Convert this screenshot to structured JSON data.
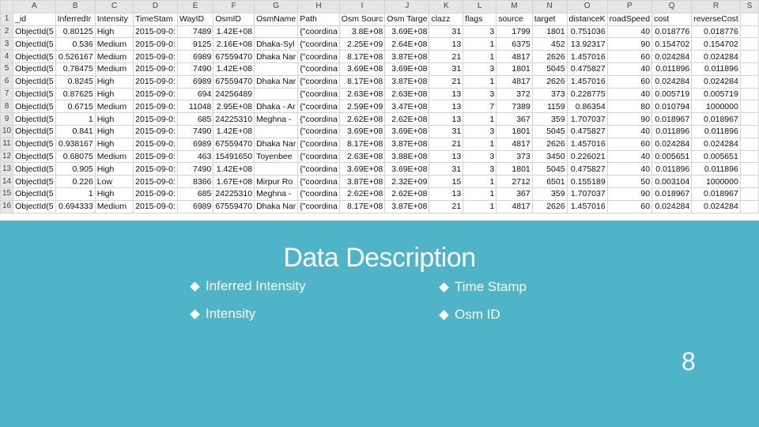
{
  "spreadsheet": {
    "column_letters": [
      "A",
      "B",
      "C",
      "D",
      "E",
      "F",
      "G",
      "H",
      "I",
      "J",
      "K",
      "L",
      "M",
      "N",
      "O",
      "P",
      "Q",
      "R",
      "S"
    ],
    "header_row": [
      "_id",
      "InferredIr",
      "Intensity",
      "TimeStam",
      "WayID",
      "OsmID",
      "OsmName",
      "Path",
      "Osm Sourc",
      "Osm Targe",
      "clazz",
      "flags",
      "source",
      "target",
      "distanceK",
      "roadSpeed",
      "cost",
      "reverseCost",
      ""
    ],
    "rows": [
      [
        "ObjectId(5",
        "0.80125",
        "High",
        "2015-09-0:",
        "7489",
        "1.42E+08",
        "",
        "{\"coordina",
        "3.8E+08",
        "3.69E+08",
        "31",
        "3",
        "1799",
        "1801",
        "0.751036",
        "40",
        "0.018776",
        "0.018776",
        ""
      ],
      [
        "ObjectId(5",
        "0.536",
        "Medium",
        "2015-09-0:",
        "9125",
        "2.16E+08",
        "Dhaka-Syl",
        "{\"coordina",
        "2.25E+09",
        "2.64E+08",
        "13",
        "1",
        "6375",
        "452",
        "13.92317",
        "90",
        "0.154702",
        "0.154702",
        ""
      ],
      [
        "ObjectId(5",
        "0.526167",
        "Medium",
        "2015-09-0:",
        "6989",
        "67559470",
        "Dhaka Nar",
        "{\"coordina",
        "8.17E+08",
        "3.87E+08",
        "21",
        "1",
        "4817",
        "2626",
        "1.457016",
        "60",
        "0.024284",
        "0.024284",
        ""
      ],
      [
        "ObjectId(5",
        "0.78475",
        "Medium",
        "2015-09-0:",
        "7490",
        "1.42E+08",
        "",
        "{\"coordina",
        "3.69E+08",
        "3.69E+08",
        "31",
        "3",
        "1801",
        "5045",
        "0.475827",
        "40",
        "0.011896",
        "0.011896",
        ""
      ],
      [
        "ObjectId(5",
        "0.8245",
        "High",
        "2015-09-0:",
        "6989",
        "67559470",
        "Dhaka Nar",
        "{\"coordina",
        "8.17E+08",
        "3.87E+08",
        "21",
        "1",
        "4817",
        "2626",
        "1.457016",
        "60",
        "0.024284",
        "0.024284",
        ""
      ],
      [
        "ObjectId(5",
        "0.87625",
        "High",
        "2015-09-0:",
        "694",
        "24256489",
        "",
        "{\"coordina",
        "2.63E+08",
        "2.63E+08",
        "13",
        "3",
        "372",
        "373",
        "0.228775",
        "40",
        "0.005719",
        "0.005719",
        ""
      ],
      [
        "ObjectId(5",
        "0.6715",
        "Medium",
        "2015-09-0:",
        "11048",
        "2.95E+08",
        "Dhaka - Ar",
        "{\"coordina",
        "2.59E+09",
        "3.47E+08",
        "13",
        "7",
        "7389",
        "1159",
        "0.86354",
        "80",
        "0.010794",
        "1000000",
        ""
      ],
      [
        "ObjectId(5",
        "1",
        "High",
        "2015-09-0:",
        "685",
        "24225310",
        "Meghna -",
        "{\"coordina",
        "2.62E+08",
        "2.62E+08",
        "13",
        "1",
        "367",
        "359",
        "1.707037",
        "90",
        "0.018967",
        "0.018967",
        ""
      ],
      [
        "ObjectId(5",
        "0.841",
        "High",
        "2015-09-0:",
        "7490",
        "1.42E+08",
        "",
        "{\"coordina",
        "3.69E+08",
        "3.69E+08",
        "31",
        "3",
        "1801",
        "5045",
        "0.475827",
        "40",
        "0.011896",
        "0.011896",
        ""
      ],
      [
        "ObjectId(5",
        "0.938167",
        "High",
        "2015-09-0:",
        "6989",
        "67559470",
        "Dhaka Nar",
        "{\"coordina",
        "8.17E+08",
        "3.87E+08",
        "21",
        "1",
        "4817",
        "2626",
        "1.457016",
        "60",
        "0.024284",
        "0.024284",
        ""
      ],
      [
        "ObjectId(5",
        "0.68075",
        "Medium",
        "2015-09-0:",
        "463",
        "15491650",
        "Toyenbee",
        "{\"coordina",
        "2.63E+08",
        "3.88E+08",
        "13",
        "3",
        "373",
        "3450",
        "0.226021",
        "40",
        "0.005651",
        "0.005651",
        ""
      ],
      [
        "ObjectId(5",
        "0.905",
        "High",
        "2015-09-0:",
        "7490",
        "1.42E+08",
        "",
        "{\"coordina",
        "3.69E+08",
        "3.69E+08",
        "31",
        "3",
        "1801",
        "5045",
        "0.475827",
        "40",
        "0.011896",
        "0.011896",
        ""
      ],
      [
        "ObjectId(5",
        "0.226",
        "Low",
        "2015-09-0:",
        "8366",
        "1.67E+08",
        "Mirpur Ro",
        "{\"coordina",
        "3.87E+08",
        "2.32E+09",
        "15",
        "1",
        "2712",
        "6501",
        "0.155189",
        "50",
        "0.003104",
        "1000000",
        ""
      ],
      [
        "ObjectId(5",
        "1",
        "High",
        "2015-09-0:",
        "685",
        "24225310",
        "Meghna -",
        "{\"coordina",
        "2.62E+08",
        "2.62E+08",
        "13",
        "1",
        "367",
        "359",
        "1.707037",
        "90",
        "0.018967",
        "0.018967",
        ""
      ],
      [
        "ObjectId(5",
        "0.694333",
        "Medium",
        "2015-09-0:",
        "6989",
        "67559470",
        "Dhaka Nar",
        "{\"coordina",
        "8.17E+08",
        "3.87E+08",
        "21",
        "1",
        "4817",
        "2626",
        "1.457016",
        "60",
        "0.024284",
        "0.024284",
        ""
      ]
    ],
    "numeric_columns": [
      1,
      4,
      5,
      8,
      9,
      10,
      11,
      12,
      13,
      14,
      15,
      16,
      17
    ]
  },
  "slide": {
    "title": "Data Description",
    "bullets_left": [
      "Inferred Intensity",
      "Intensity"
    ],
    "bullets_right": [
      "Time Stamp",
      "Osm ID"
    ],
    "page_number": "8",
    "background_color": "#4fb4c8"
  }
}
